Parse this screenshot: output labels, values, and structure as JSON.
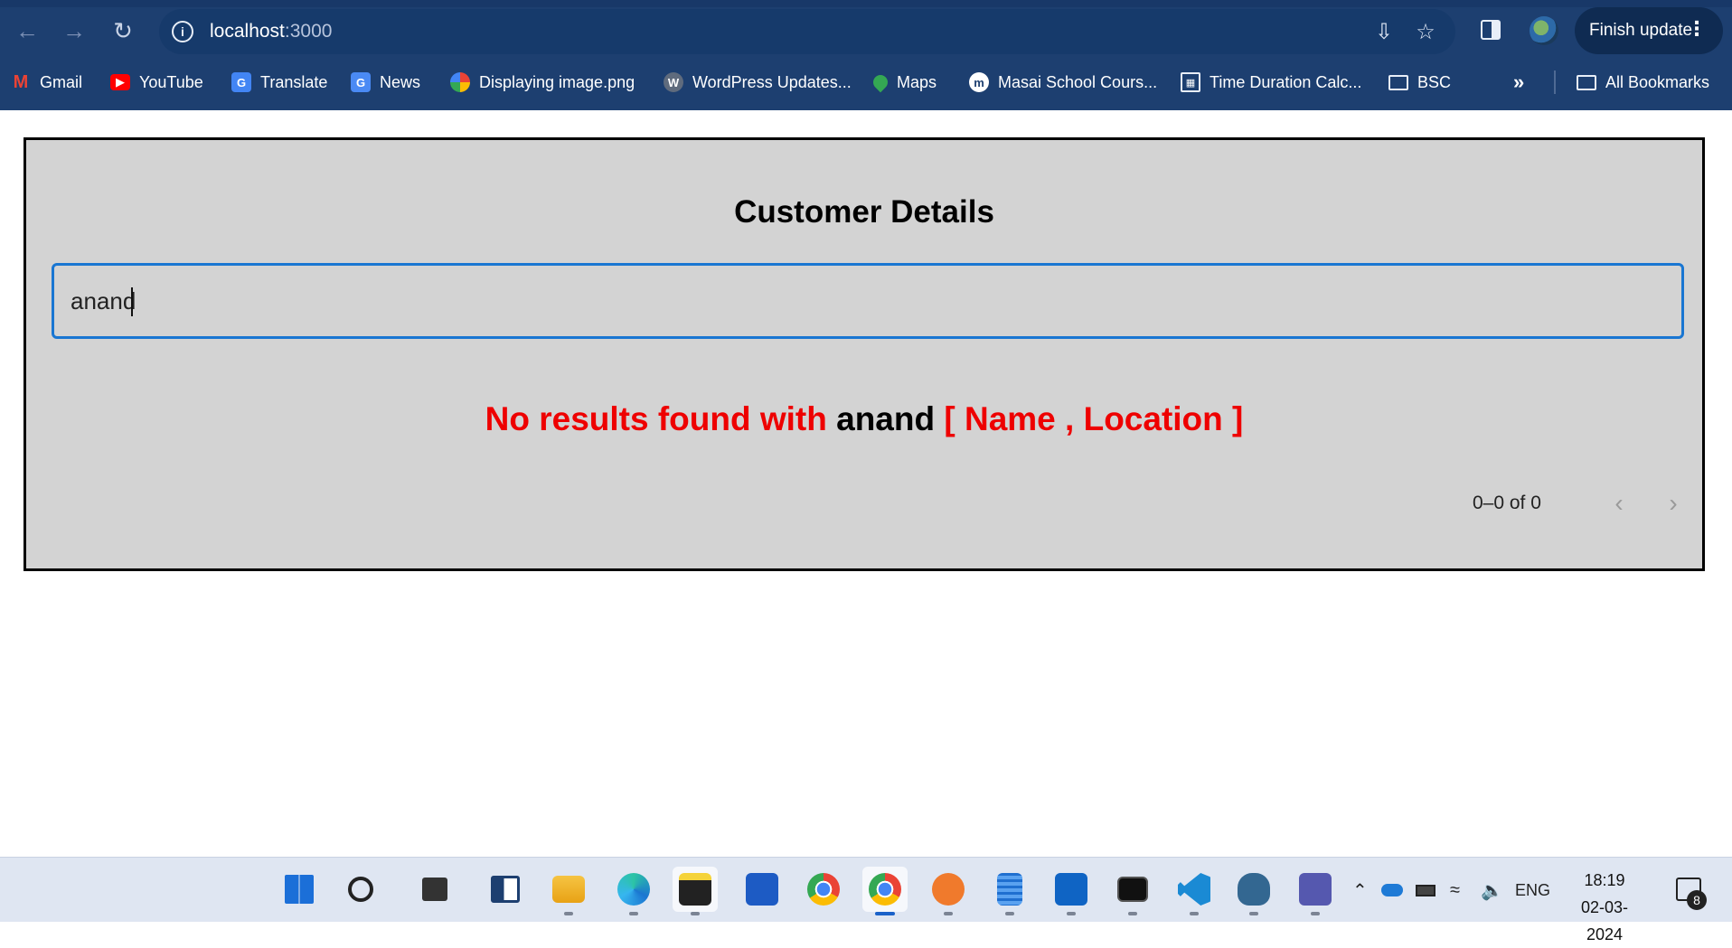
{
  "browser": {
    "url_host": "localhost",
    "url_port": ":3000",
    "finish_update_label": "Finish update",
    "bookmarks": [
      {
        "label": "Gmail",
        "icon": "gmail-icon",
        "color": "#ea4335"
      },
      {
        "label": "YouTube",
        "icon": "youtube-icon",
        "color": "#ff0000"
      },
      {
        "label": "Translate",
        "icon": "translate-icon",
        "color": "#4285f4"
      },
      {
        "label": "News",
        "icon": "news-icon",
        "color": "#4a8af4"
      },
      {
        "label": "Displaying image.png",
        "icon": "photos-icon",
        "color": "#fbbc04"
      },
      {
        "label": "WordPress Updates...",
        "icon": "wordpress-icon",
        "color": "#5f6b7d"
      },
      {
        "label": "Maps",
        "icon": "maps-icon",
        "color": "#34a853"
      },
      {
        "label": "Masai School Cours...",
        "icon": "masai-icon",
        "color": "#ffffff"
      },
      {
        "label": "Time Duration Calc...",
        "icon": "calculator-icon",
        "color": "#e8eef8"
      },
      {
        "label": "BSC",
        "icon": "folder-icon",
        "color": "#e8eef8"
      }
    ],
    "all_bookmarks_label": "All Bookmarks"
  },
  "page": {
    "title": "Customer Details",
    "search_value": "anand",
    "no_results_prefix": "No results found with ",
    "no_results_term": "anand",
    "no_results_suffix": " [ Name , Location ]",
    "pagination_label": "0–0 of 0"
  },
  "taskbar": {
    "apps": [
      "start-icon",
      "search-icon",
      "task-view-icon",
      "widgets-icon",
      "file-explorer-icon",
      "edge-icon",
      "sticky-notes-icon",
      "store-icon",
      "chrome-icon",
      "chrome-profile-icon",
      "sketch-icon",
      "notepad-icon",
      "outlook-icon",
      "terminal-icon",
      "vscode-icon",
      "postgres-icon",
      "teams-icon"
    ],
    "language": "ENG",
    "time": "18:19",
    "date": "02-03-2024",
    "notification_count": "8"
  },
  "colors": {
    "chrome_bg": "#1d3f70",
    "panel_bg": "#d3d3d3",
    "input_border": "#1976d2",
    "error_text": "#ee0000"
  }
}
